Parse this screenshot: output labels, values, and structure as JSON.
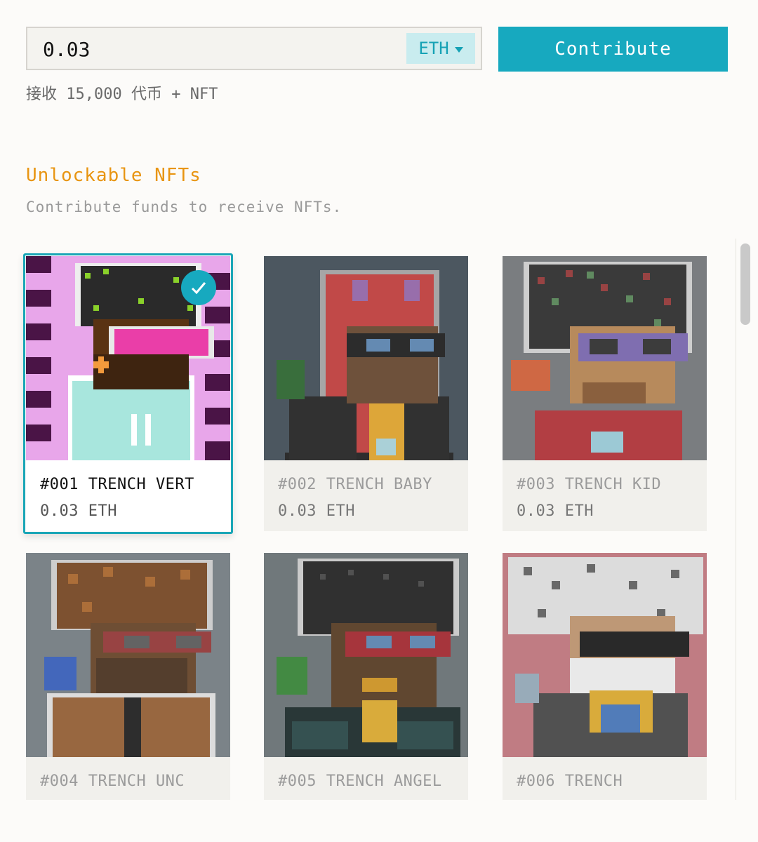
{
  "contribution": {
    "amount": "0.03",
    "currency": "ETH",
    "button_label": "Contribute",
    "receive_text": "接收 15,000 代币 + NFT"
  },
  "section": {
    "title": "Unlockable NFTs",
    "subtitle": "Contribute funds to receive NFTs."
  },
  "colors": {
    "accent": "#17a9bf",
    "title": "#e89512"
  },
  "nfts": [
    {
      "name": "#001 TRENCH VERT",
      "price": "0.03 ETH",
      "selected": true
    },
    {
      "name": "#002 TRENCH BABY",
      "price": "0.03 ETH",
      "selected": false
    },
    {
      "name": "#003 TRENCH KID",
      "price": "0.03 ETH",
      "selected": false
    },
    {
      "name": "#004 TRENCH UNC",
      "price": "",
      "selected": false
    },
    {
      "name": "#005 TRENCH ANGEL",
      "price": "",
      "selected": false
    },
    {
      "name": "#006 TRENCH",
      "price": "",
      "selected": false
    }
  ]
}
